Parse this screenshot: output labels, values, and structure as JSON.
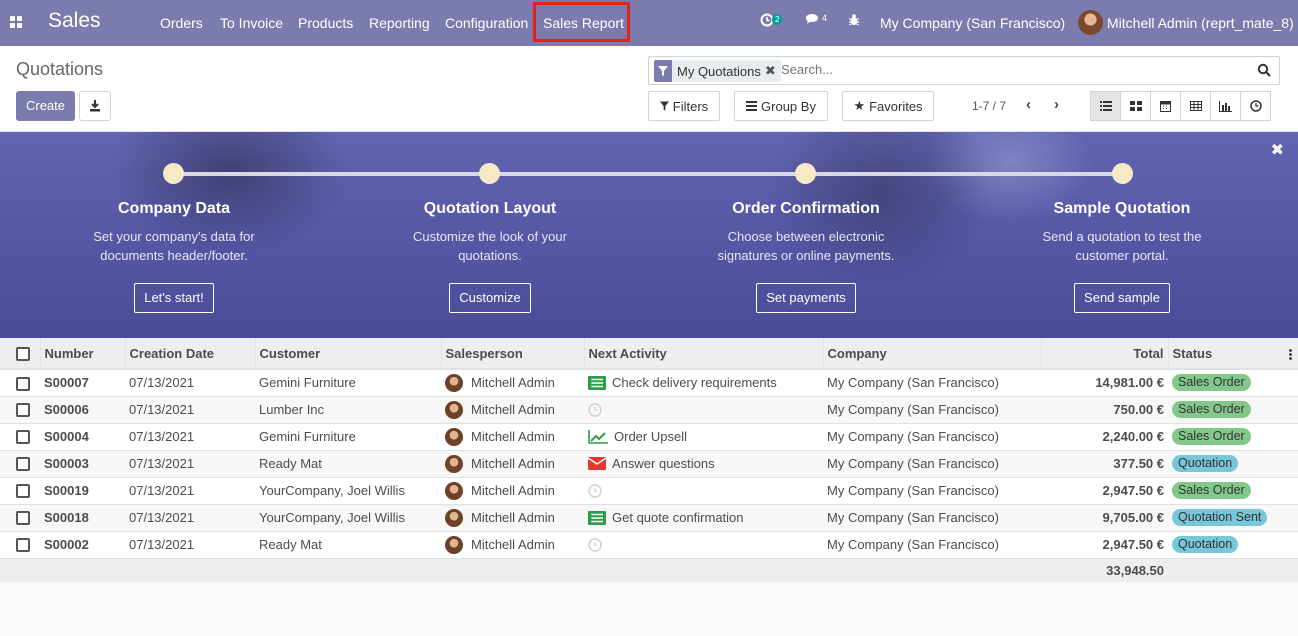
{
  "navbar": {
    "brand": "Sales",
    "menu": [
      "Orders",
      "To Invoice",
      "Products",
      "Reporting",
      "Configuration",
      "Sales Report"
    ],
    "activity_count": "2",
    "message_count": "4",
    "company": "My Company (San Francisco)",
    "user": "Mitchell Admin (reprt_mate_8)"
  },
  "control_panel": {
    "breadcrumb": "Quotations",
    "create_label": "Create",
    "facet_label": "My Quotations",
    "search_placeholder": "Search...",
    "filters_label": "Filters",
    "groupby_label": "Group By",
    "favorites_label": "Favorites",
    "pager": "1-7 / 7"
  },
  "banner": {
    "steps": [
      {
        "title": "Company Data",
        "desc1": "Set your company's data for",
        "desc2": "documents header/footer.",
        "button": "Let's start!"
      },
      {
        "title": "Quotation Layout",
        "desc1": "Customize the look of your",
        "desc2": "quotations.",
        "button": "Customize"
      },
      {
        "title": "Order Confirmation",
        "desc1": "Choose between electronic",
        "desc2": "signatures or online payments.",
        "button": "Set payments"
      },
      {
        "title": "Sample Quotation",
        "desc1": "Send a quotation to test the",
        "desc2": "customer portal.",
        "button": "Send sample"
      }
    ]
  },
  "table": {
    "columns": [
      "Number",
      "Creation Date",
      "Customer",
      "Salesperson",
      "Next Activity",
      "Company",
      "Total",
      "Status"
    ],
    "rows": [
      {
        "number": "S00007",
        "date": "07/13/2021",
        "customer": "Gemini Furniture",
        "salesperson": "Mitchell Admin",
        "activity": "Check delivery requirements",
        "activity_icon": "tasks-icon",
        "company": "My Company (San Francisco)",
        "total": "14,981.00 €",
        "status": "Sales Order"
      },
      {
        "number": "S00006",
        "date": "07/13/2021",
        "customer": "Lumber Inc",
        "salesperson": "Mitchell Admin",
        "activity": "",
        "activity_icon": "clock-icon",
        "company": "My Company (San Francisco)",
        "total": "750.00 €",
        "status": "Sales Order"
      },
      {
        "number": "S00004",
        "date": "07/13/2021",
        "customer": "Gemini Furniture",
        "salesperson": "Mitchell Admin",
        "activity": "Order Upsell",
        "activity_icon": "line-chart-icon",
        "company": "My Company (San Francisco)",
        "total": "2,240.00 €",
        "status": "Sales Order"
      },
      {
        "number": "S00003",
        "date": "07/13/2021",
        "customer": "Ready Mat",
        "salesperson": "Mitchell Admin",
        "activity": "Answer questions",
        "activity_icon": "envelope-icon",
        "company": "My Company (San Francisco)",
        "total": "377.50 €",
        "status": "Quotation"
      },
      {
        "number": "S00019",
        "date": "07/13/2021",
        "customer": "YourCompany, Joel Willis",
        "salesperson": "Mitchell Admin",
        "activity": "",
        "activity_icon": "clock-icon",
        "company": "My Company (San Francisco)",
        "total": "2,947.50 €",
        "status": "Sales Order"
      },
      {
        "number": "S00018",
        "date": "07/13/2021",
        "customer": "YourCompany, Joel Willis",
        "salesperson": "Mitchell Admin",
        "activity": "Get quote confirmation",
        "activity_icon": "tasks-icon",
        "company": "My Company (San Francisco)",
        "total": "9,705.00 €",
        "status": "Quotation Sent"
      },
      {
        "number": "S00002",
        "date": "07/13/2021",
        "customer": "Ready Mat",
        "salesperson": "Mitchell Admin",
        "activity": "",
        "activity_icon": "clock-icon",
        "company": "My Company (San Francisco)",
        "total": "2,947.50 €",
        "status": "Quotation"
      }
    ],
    "sum_total": "33,948.50"
  },
  "colors": {
    "brand": "#7c7bad",
    "sales_order": "#82c88b",
    "quotation": "#77c7da",
    "highlight": "#e0241a"
  }
}
